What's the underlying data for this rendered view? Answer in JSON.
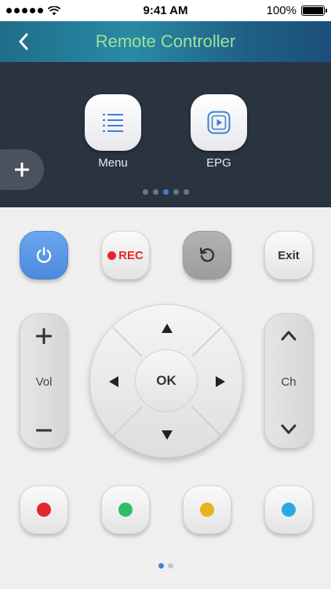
{
  "status_bar": {
    "time": "9:41 AM",
    "battery": "100%"
  },
  "header": {
    "title": "Remote Controller",
    "back_icon": "chevron-left-icon"
  },
  "quick_panel": {
    "items": [
      {
        "label": "Menu",
        "icon": "list-icon"
      },
      {
        "label": "EPG",
        "icon": "play-square-icon"
      }
    ],
    "add_icon": "plus-icon",
    "pager": {
      "pages": 5,
      "current": 3
    }
  },
  "remote": {
    "rec_label": "REC",
    "exit_label": "Exit",
    "vol_label": "Vol",
    "ch_label": "Ch",
    "ok_label": "OK",
    "colors": [
      "#e0262b",
      "#2dbe6c",
      "#e6b31c",
      "#29abe2"
    ]
  },
  "bottom_pager": {
    "pages": 2,
    "current": 1
  }
}
